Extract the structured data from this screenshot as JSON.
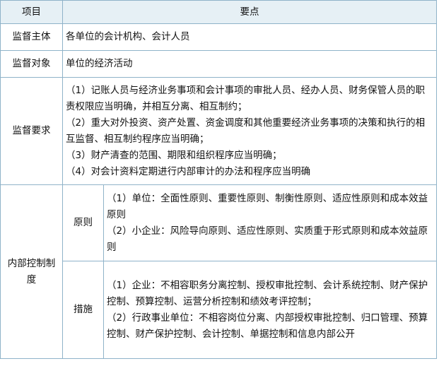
{
  "header": {
    "col1": "项目",
    "col2": "要点"
  },
  "rows": {
    "subject": {
      "label": "监督主体",
      "text": "各单位的会计机构、会计人员"
    },
    "object": {
      "label": "监督对象",
      "text": "单位的经济活动"
    },
    "requirements": {
      "label": "监督要求",
      "items": [
        "（1）记账人员与经济业务事项和会计事项的审批人员、经办人员、财务保管人员的职责权限应当明确，并相互分离、相互制约；",
        "（2）重大对外投资、资产处置、资金调度和其他重要经济业务事项的决策和执行的相互监督、相互制约程序应当明确；",
        "（3）财产清查的范围、期限和组织程序应当明确；",
        "（4）对会计资料定期进行内部审计的办法和程序应当明确"
      ]
    },
    "internal_control": {
      "label": "内部控制制度",
      "principles": {
        "label": "原则",
        "items": [
          "（1）单位：全面性原则、重要性原则、制衡性原则、适应性原则和成本效益原则",
          "（2）小企业：风险导向原则、适应性原则、实质重于形式原则和成本效益原则"
        ]
      },
      "measures": {
        "label": "措施",
        "items": [
          "（1）企业：不相容职务分离控制、授权审批控制、会计系统控制、财产保护控制、预算控制、运营分析控制和绩效考评控制；",
          "（2）行政事业单位：不相容岗位分离、内部授权审批控制、归口管理、预算控制、财产保护控制、会计控制、单据控制和信息内部公开"
        ]
      }
    }
  }
}
